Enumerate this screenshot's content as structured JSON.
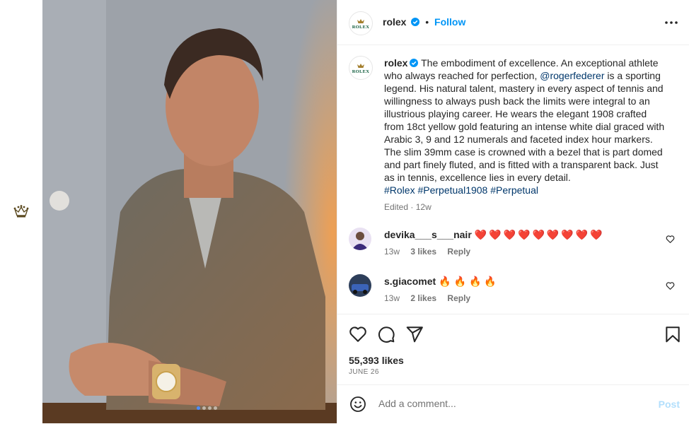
{
  "post": {
    "username": "rolex",
    "follow_label": "Follow",
    "separator": "•",
    "avatar_word": "ROLEX",
    "caption": {
      "username": "rolex",
      "text_before": " The embodiment of excellence. An exceptional athlete who always reached for perfection, ",
      "mention": "@rogerfederer",
      "text_after": " is a sporting legend. His natural talent, mastery in every aspect of tennis and willingness to always push back the limits were integral to an illustrious playing career. He wears the elegant 1908 crafted from 18ct yellow gold featuring an intense white dial graced with Arabic 3, 9 and 12 numerals and faceted index hour markers. The slim 39mm case is crowned with a bezel that is part domed and part finely fluted, and is fitted with a transparent back. Just as in tennis, excellence lies in every detail.",
      "hashtags": [
        "#Rolex",
        "#Perpetual1908",
        "#Perpetual"
      ],
      "edited": "Edited",
      "dot": "·",
      "age": "12w"
    },
    "comments": [
      {
        "username": "devika___s___nair",
        "text": "❤️❤️❤️❤️❤️❤️❤️❤️❤️",
        "age": "13w",
        "likes": "3 likes",
        "reply": "Reply"
      },
      {
        "username": "s.giacomet",
        "text": "🔥🔥🔥🔥",
        "age": "13w",
        "likes": "2 likes",
        "reply": "Reply"
      }
    ],
    "likes": "55,393 likes",
    "date": "JUNE 26",
    "comment_placeholder": "Add a comment...",
    "post_label": "Post",
    "carousel": {
      "total": 4,
      "current": 1
    }
  },
  "colors": {
    "link_blue": "#0095f6",
    "mention_blue": "#00376b",
    "rolex_green": "#0c5a3a",
    "rolex_gold": "#a37e2c"
  }
}
